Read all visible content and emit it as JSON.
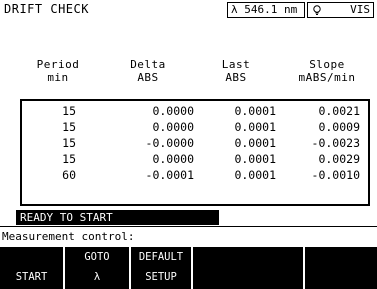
{
  "header": {
    "title": "DRIFT CHECK",
    "wavelength": "λ  546.1 nm",
    "mode_label": "VIS",
    "mode_icon": "lamp-icon"
  },
  "table": {
    "columns": [
      {
        "line1": "Period",
        "line2": "min"
      },
      {
        "line1": "Delta",
        "line2": "ABS"
      },
      {
        "line1": "Last",
        "line2": "ABS"
      },
      {
        "line1": "Slope",
        "line2": "mABS/min"
      }
    ],
    "rows": [
      [
        "15",
        "0.0000",
        "0.0001",
        "0.0021"
      ],
      [
        "15",
        "0.0000",
        "0.0001",
        "0.0009"
      ],
      [
        "15",
        "-0.0000",
        "0.0001",
        "-0.0023"
      ],
      [
        "15",
        "0.0000",
        "0.0001",
        "0.0029"
      ],
      [
        "60",
        "-0.0001",
        "0.0001",
        "-0.0010"
      ]
    ]
  },
  "status": {
    "text": "READY TO START"
  },
  "prompt": {
    "text": "Measurement control:"
  },
  "softkeys": [
    {
      "line1": "",
      "line2": "START"
    },
    {
      "line1": "GOTO",
      "line2": "λ"
    },
    {
      "line1": "DEFAULT",
      "line2": "SETUP"
    },
    {
      "line1": "",
      "line2": ""
    },
    {
      "line1": "",
      "line2": ""
    }
  ],
  "colors": {
    "background": "#ffffff",
    "foreground": "#000000"
  }
}
